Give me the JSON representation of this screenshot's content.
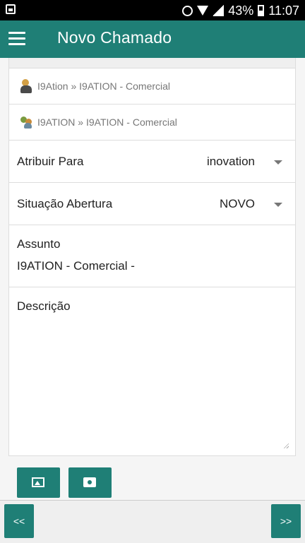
{
  "status_bar": {
    "battery_percent": "43%",
    "time": "11:07"
  },
  "app_bar": {
    "title": "Novo Chamado"
  },
  "breadcrumbs": [
    "I9Ation » I9ATION - Comercial",
    "I9ATION » I9ATION - Comercial"
  ],
  "form": {
    "assign_to": {
      "label": "Atribuir Para",
      "value": "inovation"
    },
    "opening_status": {
      "label": "Situação Abertura",
      "value": "NOVO"
    },
    "subject": {
      "label": "Assunto",
      "value": "I9ATION - Comercial -"
    },
    "description": {
      "label": "Descrição",
      "value": ""
    }
  },
  "footer": {
    "prev_label": "<<",
    "next_label": ">>"
  }
}
